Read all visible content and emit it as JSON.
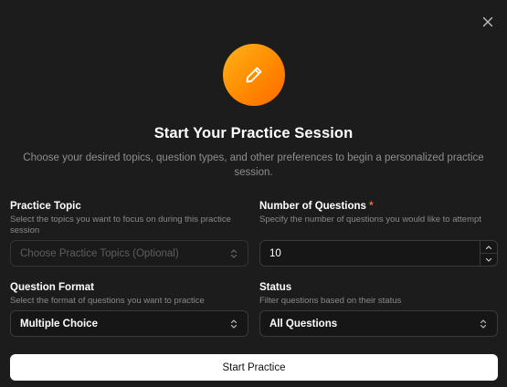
{
  "dialog": {
    "title": "Start Your Practice Session",
    "subtitle": "Choose your desired topics, question types, and other preferences to begin a personalized practice session.",
    "hero_icon": "pencil-icon",
    "close_icon": "close-icon",
    "accent_gradient": [
      "#ffb31a",
      "#ff6a00"
    ]
  },
  "fields": {
    "practice_topic": {
      "label": "Practice Topic",
      "help": "Select the topics you want to focus on during this practice session",
      "placeholder": "Choose Practice Topics (Optional)"
    },
    "number_of_questions": {
      "label": "Number of Questions",
      "required_mark": "*",
      "help": "Specify the number of questions you would like to attempt",
      "value": "10"
    },
    "question_format": {
      "label": "Question Format",
      "help": "Select the format of questions you want to practice",
      "value": "Multiple Choice"
    },
    "status": {
      "label": "Status",
      "help": "Filter questions based on their status",
      "value": "All Questions"
    }
  },
  "actions": {
    "start_label": "Start Practice"
  }
}
